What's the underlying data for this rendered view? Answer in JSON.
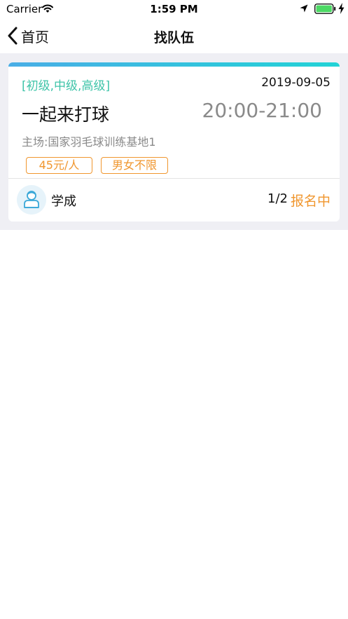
{
  "status_bar": {
    "carrier": "Carrier",
    "time": "1:59 PM",
    "icons": [
      "wifi-icon",
      "location-icon",
      "battery-icon",
      "charging-icon"
    ]
  },
  "nav": {
    "back_label": "首页",
    "title": "找队伍"
  },
  "card": {
    "levels": "[初级,中级,高级]",
    "date": "2019-09-05",
    "title": "一起来打球",
    "time_range": "20:00-21:00",
    "venue": "主场:国家羽毛球训练基地1",
    "tags": {
      "price": "45元/人",
      "gender": "男女不限"
    },
    "organizer": "学成",
    "slots": "1/2",
    "status": "报名中"
  },
  "colors": {
    "accent_orange": "#f0962e",
    "level_green": "#3fc4a9",
    "gradient_start": "#4aaee6",
    "gradient_end": "#22d3d6",
    "page_gray": "#efeff4"
  }
}
